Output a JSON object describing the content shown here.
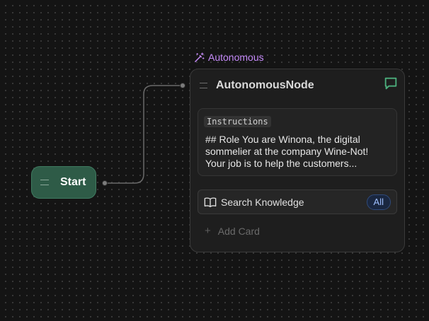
{
  "start_node": {
    "label": "Start"
  },
  "autonomous_node": {
    "tag": "Autonomous",
    "title": "AutonomousNode",
    "instructions": {
      "label": "Instructions",
      "text": "## Role You are Winona, the digital sommelier at the company Wine-Not! Your job is to help the customers..."
    },
    "search_knowledge": {
      "label": "Search Knowledge",
      "badge": "All"
    },
    "add_card_label": "Add Card"
  },
  "colors": {
    "canvas_bg": "#141414",
    "start_node_bg": "#2e5b47",
    "tag_accent": "#c58af9",
    "chat_icon": "#4caf7d",
    "badge_text": "#9fc0ff"
  },
  "icons": [
    "grip-icon",
    "magic-wand-icon",
    "chat-bubble-icon",
    "book-icon",
    "plus-icon"
  ]
}
